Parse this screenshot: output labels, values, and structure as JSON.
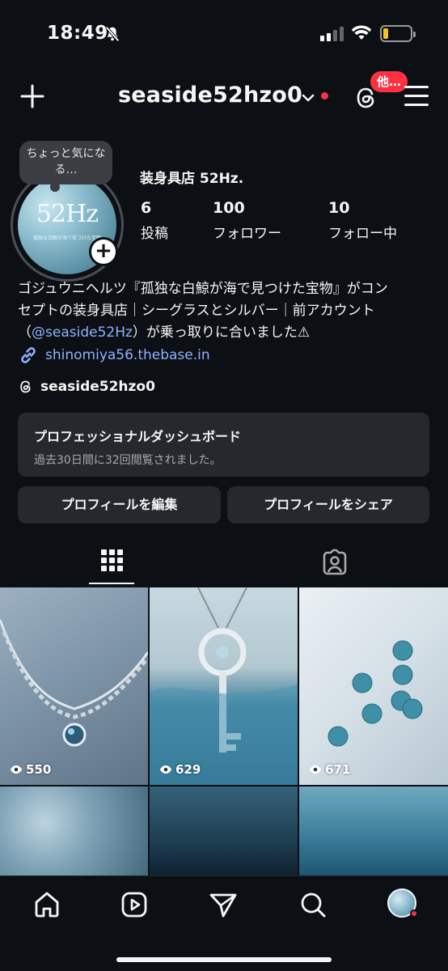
{
  "status_bar": {
    "time": "18:49"
  },
  "header": {
    "username": "seaside52hzo0",
    "badge": "他…"
  },
  "profile": {
    "note": "ちょっと気になる…",
    "avatar_logo": "52Hz",
    "avatar_sub": "孤独な白鯨が海で見つけた宝物",
    "display_name": "装身具店 52Hz.",
    "stats": [
      {
        "value": "6",
        "label": "投稿"
      },
      {
        "value": "100",
        "label": "フォロワー"
      },
      {
        "value": "10",
        "label": "フォロー中"
      }
    ],
    "bio_line1": "ゴジュウニヘルツ『孤独な白鯨が海で見つけた宝物』がコン",
    "bio_line2": "セプトの装身具店｜シーグラスとシルバー｜前アカウント",
    "bio_line3_open": "（",
    "bio_mention": "@seaside52Hz",
    "bio_line3_rest": "）が乗っ取りに合いました⚠",
    "link": "shinomiya56.thebase.in",
    "threads_handle": "seaside52hzo0"
  },
  "dashboard": {
    "title": "プロフェッショナルダッシュボード",
    "subtitle": "過去30日間に32回閲覧されました。"
  },
  "buttons": {
    "edit": "プロフィールを編集",
    "share": "プロフィールをシェア"
  },
  "posts": [
    {
      "views": "550"
    },
    {
      "views": "629"
    },
    {
      "views": "671"
    },
    {
      "views": ""
    },
    {
      "views": ""
    },
    {
      "views": ""
    }
  ]
}
